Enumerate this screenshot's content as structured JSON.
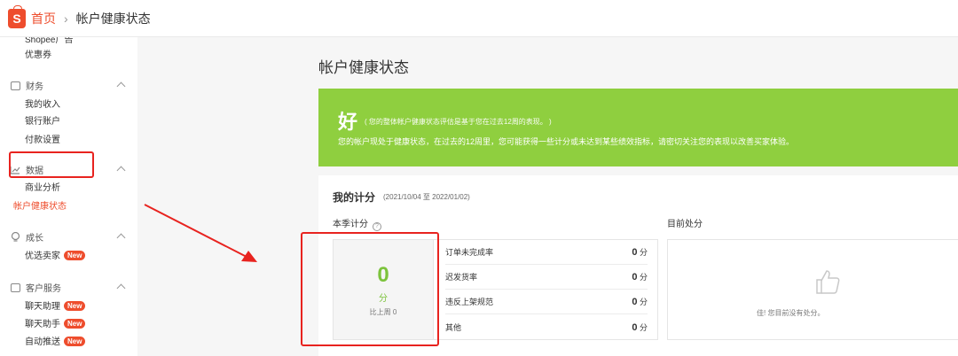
{
  "header": {
    "logo_letter": "S",
    "breadcrumb_home": "首页",
    "breadcrumb_sep": "›",
    "breadcrumb_current": "帐户健康状态"
  },
  "sidebar": {
    "partial_item": "Shopee广告",
    "voucher": "优惠券",
    "finance": {
      "title": "财务",
      "items": [
        "我的收入",
        "银行账户",
        "付款设置"
      ]
    },
    "data": {
      "title": "数据",
      "items": [
        "商业分析",
        "帐户健康状态"
      ]
    },
    "growth": {
      "title": "成长",
      "items": [
        "优选卖家"
      ]
    },
    "service": {
      "title": "客户服务",
      "items": [
        "聊天助理",
        "聊天助手",
        "自动推送"
      ]
    },
    "badge_label": "New"
  },
  "main": {
    "title": "帐户健康状态",
    "banner": {
      "status": "好",
      "note": "( 您的整体帐户健康状态评估是基于您在过去12周的表现。 )",
      "description": "您的帐户现处于健康状态，在过去的12周里，您可能获得一些计分或未达到某些绩效指标，请密切关注您的表现以改善买家体验。"
    },
    "score_card": {
      "title": "我的计分",
      "range": "(2021/10/04 至 2022/01/02)",
      "season_label": "本季计分",
      "current_label": "目前处分",
      "score": "0",
      "score_unit": "分",
      "compare": "比上周 0",
      "metrics": [
        {
          "label": "订单未完成率",
          "value": "0",
          "unit": "分"
        },
        {
          "label": "迟发货率",
          "value": "0",
          "unit": "分"
        },
        {
          "label": "违反上架规范",
          "value": "0",
          "unit": "分"
        },
        {
          "label": "其他",
          "value": "0",
          "unit": "分"
        }
      ],
      "no_penalty_text": "佳! 您目前没有处分。"
    }
  },
  "colors": {
    "brand": "#ee4d2d",
    "banner_green": "#8fcf3f",
    "score_green": "#7cc33c",
    "annotation_red": "#e8231f"
  }
}
